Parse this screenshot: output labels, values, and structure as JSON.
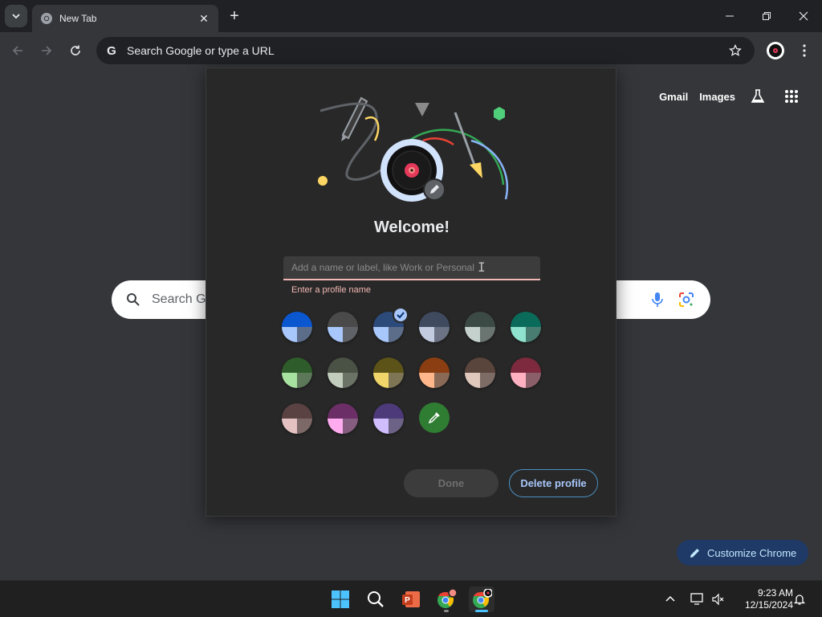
{
  "browser": {
    "tab": {
      "title": "New Tab"
    },
    "omnibox": {
      "text": "Search Google or type a URL"
    }
  },
  "ntp": {
    "links": {
      "gmail": "Gmail",
      "images": "Images"
    },
    "search_placeholder": "Search Google or type a URL",
    "customize_label": "Customize Chrome"
  },
  "dialog": {
    "welcome": "Welcome!",
    "name_placeholder": "Add a name or label, like Work or Personal",
    "name_value": "",
    "error": "Enter a profile name",
    "done_label": "Done",
    "delete_label": "Delete profile",
    "swatches": [
      {
        "top": "#0b57d0",
        "bl": "#a8c7fa",
        "br": "#5c6d8a",
        "selected": false
      },
      {
        "top": "#4a4a4a",
        "bl": "#a8c7fa",
        "br": "#5f6368",
        "selected": false
      },
      {
        "top": "#2c4a7a",
        "bl": "#a8c7fa",
        "br": "#5c6d8a",
        "selected": true
      },
      {
        "top": "#3f4a5e",
        "bl": "#c2cbe0",
        "br": "#6b7384",
        "selected": false
      },
      {
        "top": "#3c4a46",
        "bl": "#c4d1cd",
        "br": "#6a7572",
        "selected": false
      },
      {
        "top": "#0b6b5a",
        "bl": "#8fe2cd",
        "br": "#4a7d72",
        "selected": false
      },
      {
        "top": "#2e5c2a",
        "bl": "#a8e2a0",
        "br": "#5c7859",
        "selected": false
      },
      {
        "top": "#4a5246",
        "bl": "#c3cdbd",
        "br": "#6b7367",
        "selected": false
      },
      {
        "top": "#5c5318",
        "bl": "#f0d56a",
        "br": "#7d7553",
        "selected": false
      },
      {
        "top": "#8a3e12",
        "bl": "#ffb68a",
        "br": "#8a6a57",
        "selected": false
      },
      {
        "top": "#5a453c",
        "bl": "#e0c8bd",
        "br": "#7d6c65",
        "selected": false
      },
      {
        "top": "#7d2a3e",
        "bl": "#ffb1c1",
        "br": "#8a5f69",
        "selected": false
      },
      {
        "top": "#5a4242",
        "bl": "#e5c2c2",
        "br": "#7d6868",
        "selected": false
      },
      {
        "top": "#6b2e66",
        "bl": "#ffabf0",
        "br": "#855d80",
        "selected": false
      },
      {
        "top": "#4c3a7a",
        "bl": "#cfbdfe",
        "br": "#6c6285",
        "selected": false
      }
    ]
  },
  "taskbar": {
    "time": "9:23 AM",
    "date": "12/15/2024"
  },
  "colors": {
    "accent": "#a8c7fa",
    "error": "#f2b8b5",
    "page_bg": "#35363a",
    "dialog_bg": "#282828"
  }
}
